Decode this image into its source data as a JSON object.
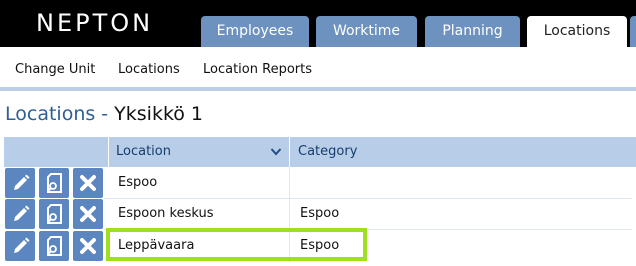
{
  "app": {
    "logo": "NEPTON"
  },
  "tabs": [
    {
      "label": "Employees",
      "active": false
    },
    {
      "label": "Worktime",
      "active": false
    },
    {
      "label": "Planning",
      "active": false
    },
    {
      "label": "Locations",
      "active": true
    }
  ],
  "subnav": [
    "Change Unit",
    "Locations",
    "Location Reports"
  ],
  "page": {
    "title_label": "Locations -",
    "unit_name": "Yksikkö 1"
  },
  "table": {
    "columns": [
      "Location",
      "Category"
    ],
    "rows": [
      {
        "location": "Espoo",
        "category": ""
      },
      {
        "location": "Espoon keskus",
        "category": "Espoo"
      },
      {
        "location": "Leppävaara",
        "category": "Espoo"
      }
    ],
    "row_actions": [
      "edit-icon",
      "view-document-icon",
      "delete-icon"
    ],
    "highlighted_row": 2
  },
  "colors": {
    "tab_bg": "#6d92c0",
    "header_bg": "#b8cde8",
    "action_btn": "#5b86bf",
    "title_blue": "#2e5f95",
    "highlight": "#9ee01b"
  }
}
